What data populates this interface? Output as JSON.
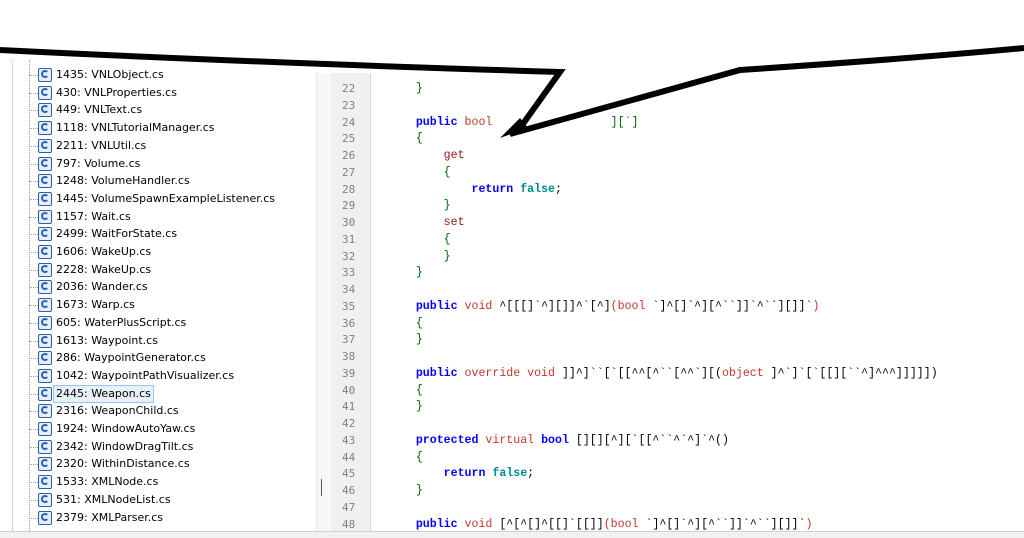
{
  "file_tree": {
    "items": [
      {
        "label": "1435: VNLObject.cs"
      },
      {
        "label": "430: VNLProperties.cs"
      },
      {
        "label": "449: VNLText.cs"
      },
      {
        "label": "1118: VNLTutorialManager.cs"
      },
      {
        "label": "2211: VNLUtil.cs"
      },
      {
        "label": "797: Volume.cs"
      },
      {
        "label": "1248: VolumeHandler.cs"
      },
      {
        "label": "1445: VolumeSpawnExampleListener.cs"
      },
      {
        "label": "1157: Wait.cs"
      },
      {
        "label": "2499: WaitForState.cs"
      },
      {
        "label": "1606: WakeUp.cs"
      },
      {
        "label": "2228: WakeUp.cs"
      },
      {
        "label": "2036: Wander.cs"
      },
      {
        "label": "1673: Warp.cs"
      },
      {
        "label": "605: WaterPlusScript.cs"
      },
      {
        "label": "1613: Waypoint.cs"
      },
      {
        "label": "286: WaypointGenerator.cs"
      },
      {
        "label": "1042: WaypointPathVisualizer.cs"
      },
      {
        "label": "2445: Weapon.cs"
      },
      {
        "label": "2316: WeaponChild.cs"
      },
      {
        "label": "1924: WindowAutoYaw.cs"
      },
      {
        "label": "2342: WindowDragTilt.cs"
      },
      {
        "label": "2320: WithinDistance.cs"
      },
      {
        "label": "1533: XMLNode.cs"
      },
      {
        "label": "531: XMLNodeList.cs"
      },
      {
        "label": "2379: XMLParser.cs"
      }
    ],
    "selected_index": 18
  },
  "editor": {
    "lines": [
      {
        "no": "22",
        "parts": [
          {
            "c": "pun",
            "t": "    }"
          }
        ]
      },
      {
        "no": "23",
        "parts": []
      },
      {
        "no": "24",
        "parts": [
          {
            "c": "kw",
            "t": "    public "
          },
          {
            "c": "ty",
            "t": "bool"
          },
          {
            "c": "txt",
            "t": "                 "
          },
          {
            "c": "pun",
            "t": "][`]"
          }
        ]
      },
      {
        "no": "25",
        "parts": [
          {
            "c": "pun",
            "t": "    {"
          }
        ]
      },
      {
        "no": "26",
        "parts": [
          {
            "c": "acc",
            "t": "        get"
          }
        ]
      },
      {
        "no": "27",
        "parts": [
          {
            "c": "pun",
            "t": "        {"
          }
        ]
      },
      {
        "no": "28",
        "parts": [
          {
            "c": "kw",
            "t": "            return "
          },
          {
            "c": "lit",
            "t": "false"
          },
          {
            "c": "txt",
            "t": ";"
          }
        ]
      },
      {
        "no": "29",
        "parts": [
          {
            "c": "pun",
            "t": "        }"
          }
        ]
      },
      {
        "no": "30",
        "parts": [
          {
            "c": "acc",
            "t": "        set"
          }
        ]
      },
      {
        "no": "31",
        "parts": [
          {
            "c": "pun",
            "t": "        {"
          }
        ]
      },
      {
        "no": "32",
        "parts": [
          {
            "c": "pun",
            "t": "        }"
          }
        ]
      },
      {
        "no": "33",
        "parts": [
          {
            "c": "pun",
            "t": "    }"
          }
        ]
      },
      {
        "no": "34",
        "parts": []
      },
      {
        "no": "35",
        "parts": [
          {
            "c": "kw",
            "t": "    public "
          },
          {
            "c": "ty",
            "t": "void "
          },
          {
            "c": "txt",
            "t": "^[[[]`^][]]^`[^]"
          },
          {
            "c": "ty",
            "t": "(bool "
          },
          {
            "c": "txt",
            "t": "`]^[]`^][^``]]`^``][]]`"
          },
          {
            "c": "ty",
            "t": ")"
          }
        ]
      },
      {
        "no": "36",
        "parts": [
          {
            "c": "pun",
            "t": "    {"
          }
        ]
      },
      {
        "no": "37",
        "parts": [
          {
            "c": "pun",
            "t": "    }"
          }
        ]
      },
      {
        "no": "38",
        "parts": []
      },
      {
        "no": "39",
        "parts": [
          {
            "c": "kw",
            "t": "    public "
          },
          {
            "c": "ty",
            "t": "override void "
          },
          {
            "c": "txt",
            "t": "]]^]``[`[[^^[^``[^^`][("
          },
          {
            "c": "ty",
            "t": "object "
          },
          {
            "c": "txt",
            "t": "]^`]`[`[[][``^]^^^]]]]])"
          }
        ]
      },
      {
        "no": "40",
        "parts": [
          {
            "c": "pun",
            "t": "    {"
          }
        ]
      },
      {
        "no": "41",
        "parts": [
          {
            "c": "pun",
            "t": "    }"
          }
        ]
      },
      {
        "no": "42",
        "parts": []
      },
      {
        "no": "43",
        "parts": [
          {
            "c": "kw",
            "t": "    protected "
          },
          {
            "c": "ty",
            "t": "virtual "
          },
          {
            "c": "kw",
            "t": "bool "
          },
          {
            "c": "txt",
            "t": "[][][^][`[[^``^`^]`^()"
          }
        ]
      },
      {
        "no": "44",
        "parts": [
          {
            "c": "pun",
            "t": "    {"
          }
        ]
      },
      {
        "no": "45",
        "parts": [
          {
            "c": "kw",
            "t": "        return "
          },
          {
            "c": "lit",
            "t": "false"
          },
          {
            "c": "txt",
            "t": ";"
          }
        ]
      },
      {
        "no": "46",
        "parts": [
          {
            "c": "pun",
            "t": "    }"
          }
        ]
      },
      {
        "no": "47",
        "parts": []
      },
      {
        "no": "48",
        "parts": [
          {
            "c": "kw",
            "t": "    public "
          },
          {
            "c": "ty",
            "t": "void "
          },
          {
            "c": "txt",
            "t": "[^[^[]^[[]`[[]]"
          },
          {
            "c": "ty",
            "t": "(bool "
          },
          {
            "c": "txt",
            "t": "`]^[]`^][^``]]`^``][]]`"
          },
          {
            "c": "ty",
            "t": ")"
          }
        ]
      }
    ]
  },
  "colors": {
    "keyword": "#0000ff",
    "type": "#c0392b",
    "literal": "#008b8b",
    "punct": "#006400",
    "annotation_arrow": "#000000"
  }
}
